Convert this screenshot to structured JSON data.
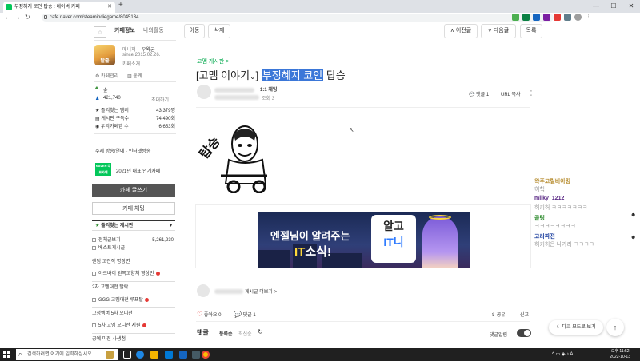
{
  "browser": {
    "tab_title": "부정혜지 코인 탑승 : 네이버 카페",
    "url": "cafe.naver.com/steamindiegame/8045134",
    "new_tab": "+",
    "window_controls": [
      "—",
      "☐",
      "✕"
    ]
  },
  "sidebar": {
    "tab_info": "카페정보",
    "tab_activity": "나의활동",
    "manager_label": "매니저",
    "manager_name": "우왁굳",
    "since": "since 2015.02.26.",
    "cafe_intro": "카페소개",
    "cafe_manage": "카페관리",
    "stats": "통계",
    "level": "숲",
    "member_count": "421,740",
    "invite": "초대하기",
    "stat_rows": [
      {
        "label": "즐겨찾는 멤버",
        "value": "43,379명"
      },
      {
        "label": "게시판 구독수",
        "value": "74,490회"
      },
      {
        "label": "우리카페앱 수",
        "value": "6,653회"
      }
    ],
    "topic": "주제 방송/연예 · 인터넷방송",
    "award_badge": "NAVER 대표카페",
    "award_text": "2021년 대표 인기카페",
    "write_button": "카페 글쓰기",
    "chat_button": "카페 채팅",
    "board_header": "즐겨찾는 게시판",
    "board_header_arrow": "▾",
    "board_top_label": "전체글보기",
    "board_top_count": "5,261,230",
    "menu_items": [
      "베스트게시글",
      "랜덤 고전작 명장면",
      "아르바이 왼쪽고양처 영상만",
      "2차 고멤대전 탈락",
      "GGG 고멤대전 루프탈",
      "고정멤버 5차 오디션",
      "5차 고멤 오디션 지원",
      "공예 미전 사생첨"
    ]
  },
  "post": {
    "move_button": "이동",
    "delete_button": "삭제",
    "prev_button": "∧ 이전글",
    "next_button": "∨ 다음글",
    "list_button": "목록",
    "board_link": "고멤 게시판 >",
    "title_prefix": "[고멤 이야기",
    "title_chevron": "⌄",
    "title_bracket": "]",
    "title_highlight": "부정혜지 코인",
    "title_rest": "탑승",
    "chat_label": "1:1 채팅",
    "views_label": "조회 3",
    "comment_count_label": "댓글 1",
    "url_copy": "URL 복사",
    "more": "⋮",
    "meme_text": "탑승",
    "author_more": "게시글 더보기 >",
    "like_label": "좋아요 0",
    "comment_label": "댓글 1",
    "share_label": "공유",
    "report_label": "신고",
    "comments_title": "댓글",
    "sort_register": "등록순",
    "sort_recent": "최신순",
    "refresh": "↻",
    "comment_alarm": "댓글알림",
    "dark_mode": "다크 모드로 보기",
    "top": "↑"
  },
  "banner": {
    "line1_a": "엔젤님이 알려주는",
    "line2_a": "IT",
    "line2_b": "소식!",
    "logo_top": "알고",
    "logo_bottom": "IT니"
  },
  "chat": [
    {
      "name": "왁주고릴비아킹",
      "name_color": "#b58a2b",
      "msg": "허헉"
    },
    {
      "name": "milky_1212",
      "name_color": "#5b2a86",
      "msg": "허키허 ㅋㅋㅋㅋㅋㅋㅋ"
    },
    {
      "name": "골링",
      "name_color": "#2e8b2e",
      "msg": "ㅋㅋㅋㅋㅋㅋㅋㅋ"
    },
    {
      "name": "고라파젼",
      "name_color": "#1c3f9f",
      "msg": "허키허은 나가라 ㅋㅋㅋㅋ"
    }
  ],
  "taskbar": {
    "search_placeholder": "검색하려면 여기에 입력하십시오.",
    "time": "오후 11:52",
    "date": "2022-10-13"
  },
  "colors": {
    "accent_green": "#03c75a",
    "highlight_blue": "#3b77d8"
  }
}
